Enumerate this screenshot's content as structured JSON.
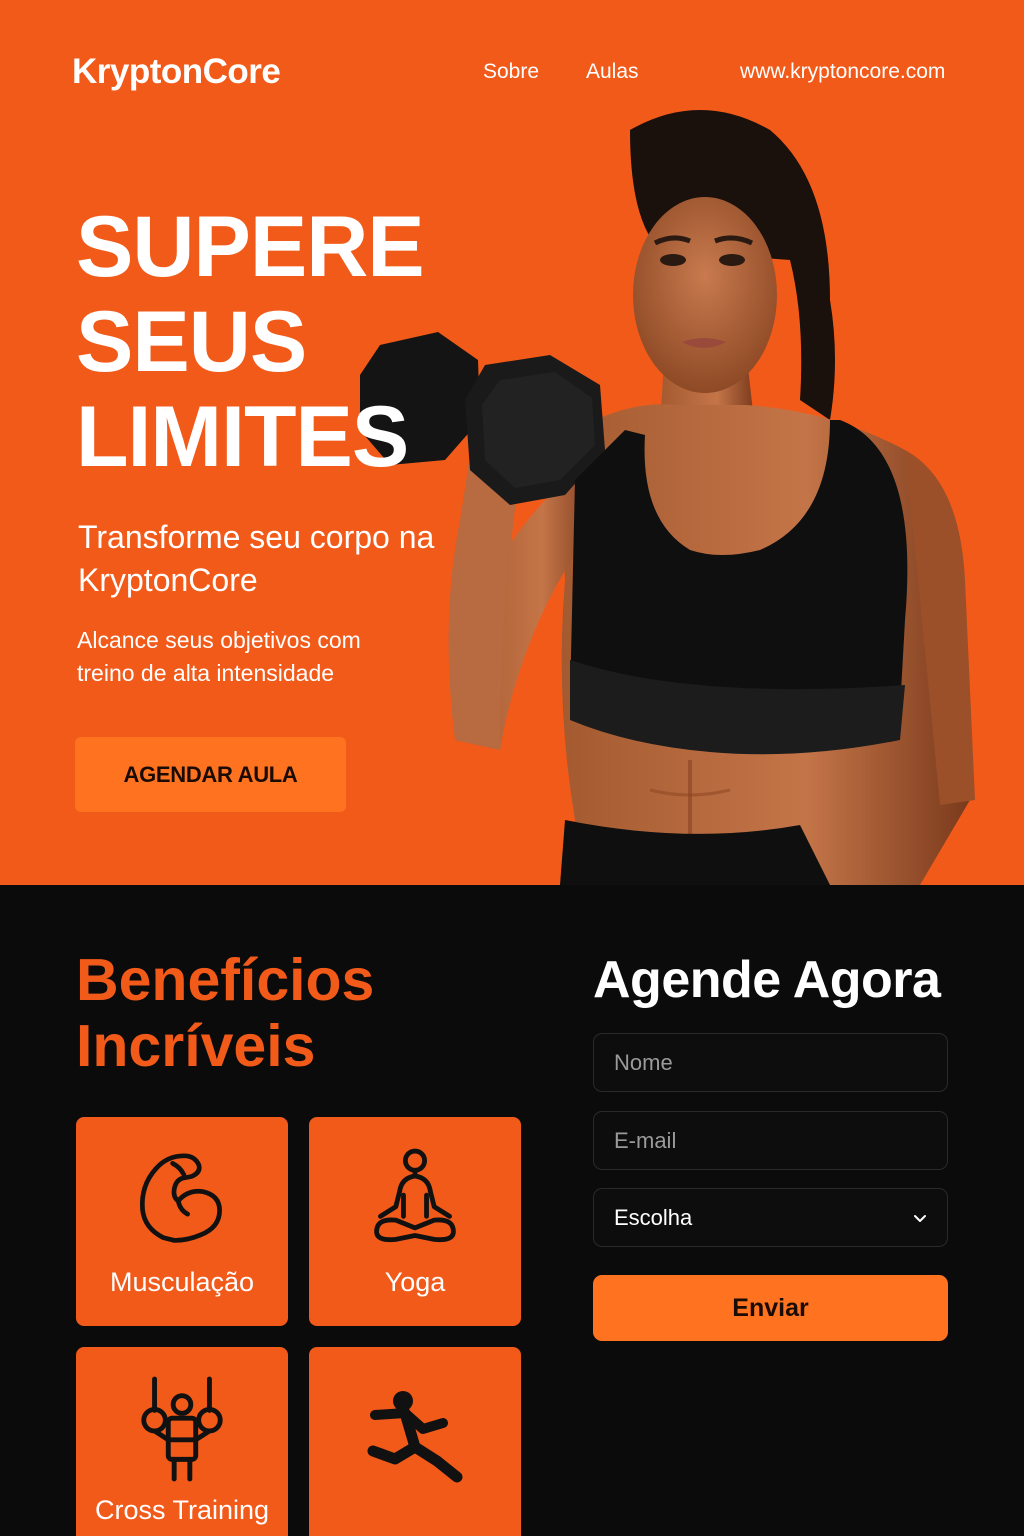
{
  "header": {
    "brand": "KryptonCore",
    "nav": [
      {
        "label": "Sobre"
      },
      {
        "label": "Aulas"
      }
    ],
    "site_url": "www.kryptoncore.com"
  },
  "hero": {
    "headline": [
      "SUPERE",
      "SEUS",
      "LIMITES"
    ],
    "subhead": "Transforme seu corpo na KryptonCore",
    "tagline": "Alcance seus objetivos com treino de alta intensidade",
    "cta_label": "AGENDAR AULA",
    "image": "woman-with-dumbbell-photo"
  },
  "benefits": {
    "title": [
      "Benefícios",
      "Incríveis"
    ],
    "cards": [
      {
        "label": "Musculação",
        "icon": "flexed-arm-icon"
      },
      {
        "label": "Yoga",
        "icon": "meditation-pose-icon"
      },
      {
        "label": "Cross Training",
        "icon": "gymnastic-rings-icon"
      },
      {
        "label": "",
        "icon": "running-figure-icon"
      }
    ]
  },
  "booking_form": {
    "title": "Agende Agora",
    "name_placeholder": "Nome",
    "email_placeholder": "E-mail",
    "select_value": "Escolha",
    "submit_label": "Enviar"
  },
  "colors": {
    "brand_orange": "#f25a1a",
    "button_orange": "#ff7320",
    "dark_bg": "#0b0b0b"
  }
}
